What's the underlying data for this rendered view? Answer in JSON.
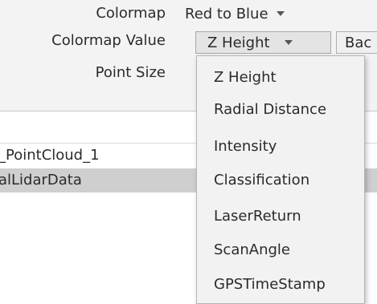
{
  "properties": {
    "colormap_label": "Colormap",
    "colormap_value_label": "Colormap Value",
    "point_size_label": "Point Size",
    "colormap_selected": "Red to Blue",
    "colormap_value_selected": "Z Height",
    "back_button_partial": "Bac"
  },
  "tree": {
    "rows": [
      {
        "label": "_PointCloud_1",
        "selected": false
      },
      {
        "label": "alLidarData",
        "selected": true
      }
    ]
  },
  "dropdown": {
    "options": [
      "Z Height",
      "Radial Distance",
      "Intensity",
      "Classification",
      "LaserReturn",
      "ScanAngle",
      "GPSTimeStamp"
    ]
  },
  "colors": {
    "panel_bg": "#f3f3f3",
    "selected_row_bg": "#cfcfcf",
    "dropdown_bg": "#f2f2f2"
  }
}
